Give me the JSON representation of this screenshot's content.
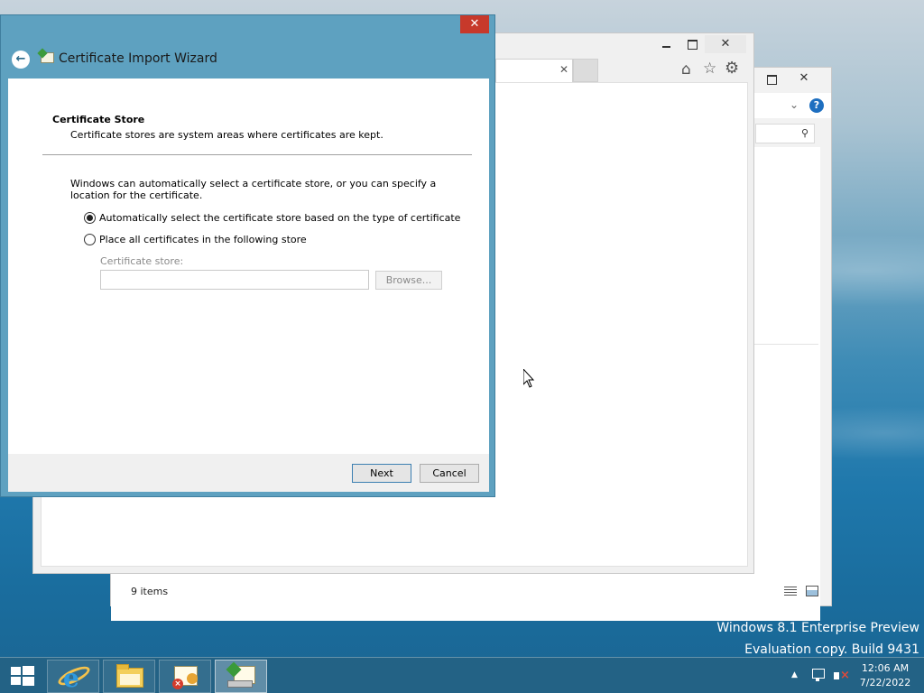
{
  "desktop": {
    "watermark_line1": "Windows 8.1 Enterprise Preview",
    "watermark_line2": "Evaluation copy. Build 9431"
  },
  "explorer": {
    "status_items": "9 items",
    "close_glyph": "✕"
  },
  "browser": {
    "close_glyph": "✕",
    "tab_close_glyph": "✕"
  },
  "wizard": {
    "title": "Certificate Import Wizard",
    "close_glyph": "✕",
    "back_glyph": "←",
    "section_heading": "Certificate Store",
    "section_subheading": "Certificate stores are system areas where certificates are kept.",
    "description": "Windows can automatically select a certificate store, or you can specify a location for the certificate.",
    "option_auto": "Automatically select the certificate store based on the type of certificate",
    "option_manual": "Place all certificates in the following store",
    "option_selected": "auto",
    "store_label": "Certificate store:",
    "store_value": "",
    "browse_label": "Browse...",
    "next_label": "Next",
    "cancel_label": "Cancel"
  },
  "taskbar": {
    "items": [
      "start-button",
      "internet-explorer",
      "file-explorer",
      "certificate-manager",
      "certificate-import-wizard"
    ],
    "active_item": "certificate-import-wizard",
    "time": "12:06 AM",
    "date": "7/22/2022"
  },
  "colors": {
    "dialog_frame": "#5ea1c0",
    "close_button": "#c7392b",
    "taskbar": "#246282"
  }
}
